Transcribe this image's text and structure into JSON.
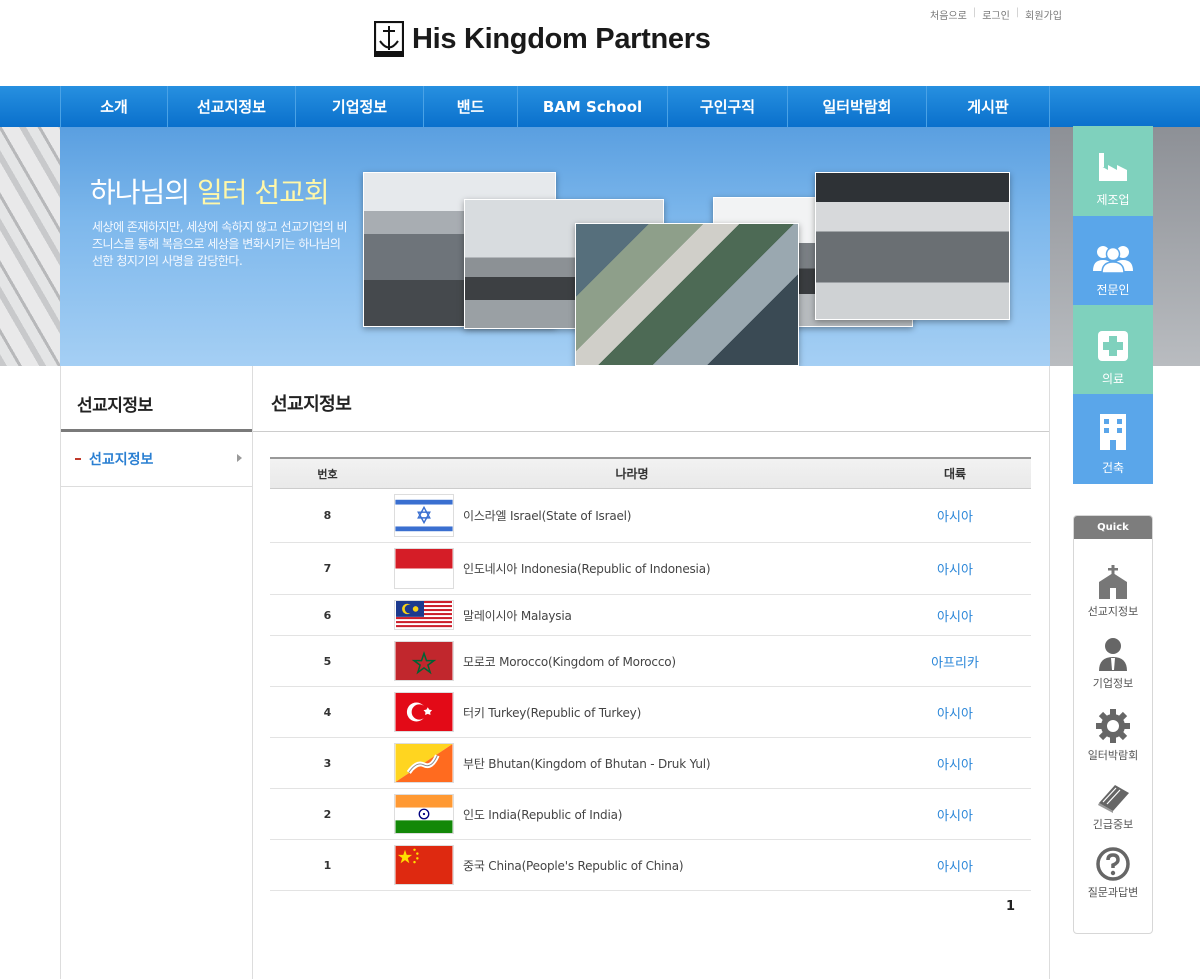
{
  "header": {
    "site_title": "His Kingdom Partners",
    "util_links": [
      "처음으로",
      "로그인",
      "회원가입"
    ]
  },
  "nav": {
    "items": [
      "소개",
      "선교지정보",
      "기업정보",
      "밴드",
      "BAM School",
      "구인구직",
      "일터박람회",
      "게시판"
    ]
  },
  "banner": {
    "title_main": "하나님의 ",
    "title_highlight": "일터 선교회",
    "description": "세상에 존재하지만, 세상에 속하지 않고 선교기업의 비즈니스를 통해 복음으로 세상을 변화시키는 하나님의 선한 청지기의 사명을 감당한다."
  },
  "categories": [
    {
      "label": "제조업",
      "icon": "factory-icon",
      "color": "#7fd1bd"
    },
    {
      "label": "전문인",
      "icon": "people-icon",
      "color": "#5aa6ea"
    },
    {
      "label": "의료",
      "icon": "medical-cross-icon",
      "color": "#7fd1bd"
    },
    {
      "label": "건축",
      "icon": "building-icon",
      "color": "#5aa6ea"
    }
  ],
  "quick": {
    "title": "Quick",
    "items": [
      {
        "label": "선교지정보",
        "icon": "church-icon"
      },
      {
        "label": "기업정보",
        "icon": "person-icon"
      },
      {
        "label": "일터박람회",
        "icon": "gear-icon"
      },
      {
        "label": "긴급중보",
        "icon": "book-icon"
      },
      {
        "label": "질문과답변",
        "icon": "question-icon"
      }
    ]
  },
  "lnb": {
    "title": "선교지정보",
    "items": [
      "선교지정보"
    ]
  },
  "main": {
    "title": "선교지정보",
    "columns": [
      "번호",
      "나라명",
      "대륙"
    ],
    "rows": [
      {
        "num": "8",
        "name": "이스라엘 Israel(State of Israel)",
        "continent": "아시아",
        "flag": "israel"
      },
      {
        "num": "7",
        "name": "인도네시아 Indonesia(Republic of Indonesia)",
        "continent": "아시아",
        "flag": "indonesia"
      },
      {
        "num": "6",
        "name": "말레이시아 Malaysia",
        "continent": "아시아",
        "flag": "malaysia"
      },
      {
        "num": "5",
        "name": "모로코 Morocco(Kingdom of Morocco)",
        "continent": "아프리카",
        "flag": "morocco"
      },
      {
        "num": "4",
        "name": "터키 Turkey(Republic of Turkey)",
        "continent": "아시아",
        "flag": "turkey"
      },
      {
        "num": "3",
        "name": "부탄 Bhutan(Kingdom of Bhutan - Druk Yul)",
        "continent": "아시아",
        "flag": "bhutan"
      },
      {
        "num": "2",
        "name": "인도 India(Republic of India)",
        "continent": "아시아",
        "flag": "india"
      },
      {
        "num": "1",
        "name": "중국 China(People's Republic of China)",
        "continent": "아시아",
        "flag": "china"
      }
    ],
    "pagination": [
      "1"
    ]
  }
}
